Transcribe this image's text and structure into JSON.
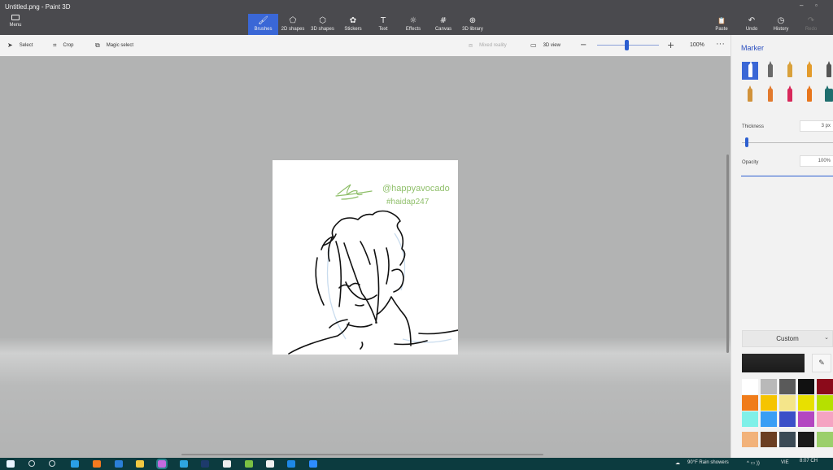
{
  "window": {
    "title": "Untitled.png - Paint 3D"
  },
  "ribbon": {
    "menu_label": "Menu",
    "tools": [
      {
        "label": "Brushes",
        "glyph": "🖌",
        "icon": "brush-icon"
      },
      {
        "label": "2D shapes",
        "glyph": "⬠",
        "icon": "shapes-2d-icon"
      },
      {
        "label": "3D shapes",
        "glyph": "⬡",
        "icon": "shapes-3d-icon"
      },
      {
        "label": "Stickers",
        "glyph": "✿",
        "icon": "sticker-icon"
      },
      {
        "label": "Text",
        "glyph": "T",
        "icon": "text-icon"
      },
      {
        "label": "Effects",
        "glyph": "☼",
        "icon": "effects-icon"
      },
      {
        "label": "Canvas",
        "glyph": "#",
        "icon": "canvas-icon"
      },
      {
        "label": "3D library",
        "glyph": "⊕",
        "icon": "library-icon"
      }
    ],
    "right_tools": [
      {
        "label": "Paste",
        "glyph": "📋",
        "icon": "paste-icon"
      },
      {
        "label": "Undo",
        "glyph": "↶",
        "icon": "undo-icon"
      },
      {
        "label": "History",
        "glyph": "◷",
        "icon": "history-icon"
      },
      {
        "label": "Redo",
        "glyph": "↷",
        "icon": "redo-icon"
      }
    ]
  },
  "toolbar": {
    "select": "Select",
    "crop": "Crop",
    "magic_select": "Magic select",
    "mixed_reality": "Mixed reality",
    "view_3d": "3D view",
    "zoom_value": "100%",
    "zoom_level": 0.45,
    "more": "···"
  },
  "canvas": {
    "handle_text": "@happyavocado",
    "hashtag_text": "#haidap247",
    "ink_color": "#111111",
    "accent_color": "#8fbf6a"
  },
  "panel": {
    "title": "Marker",
    "thickness_label": "Thickness",
    "thickness_value": "3 px",
    "thickness_level": 0.03,
    "opacity_label": "Opacity",
    "opacity_value": "100%",
    "custom_label": "Custom",
    "brushes_row1": [
      "#2b4fbf",
      "#6a6a6a",
      "#d9a13b",
      "#e39b2c",
      "#555"
    ],
    "brushes_row2": [
      "#d1923a",
      "#e27a2e",
      "#d8285b",
      "#e8761c",
      "#1f6e6e"
    ],
    "swatches": [
      "#ffffff",
      "#b9b9b9",
      "#5a5a5a",
      "#111111",
      "#8b0a1a",
      "#e31b23",
      "#f07c1a",
      "#f5c400",
      "#f4e58a",
      "#e8e000",
      "#b6e000",
      "#3bb34a",
      "#7ff0e8",
      "#3a9ef5",
      "#3b4fc8",
      "#b347c1",
      "#f5a3c2",
      "#c98555",
      "#f2b27a",
      "#6b3e22",
      "#3b4a55",
      "#1a1a1a",
      "#9bcf6b",
      "#6aa83a"
    ]
  },
  "taskbar": {
    "weather": "90°F  Rain showers",
    "lang": "VIE",
    "time": "8:07 CH",
    "icons": [
      {
        "name": "start-icon",
        "color": "#e8f4ff"
      },
      {
        "name": "search-icon",
        "color": "#cfd8dc"
      },
      {
        "name": "cortana-icon",
        "color": "#cfd8dc"
      },
      {
        "name": "edge-icon",
        "color": "#2aa0e6"
      },
      {
        "name": "firefox-icon",
        "color": "#f57a1f"
      },
      {
        "name": "mail-icon",
        "color": "#2b7fd8"
      },
      {
        "name": "explorer-icon",
        "color": "#f3c842"
      },
      {
        "name": "paint3d-icon",
        "color": "#c46adf"
      },
      {
        "name": "telegram-icon",
        "color": "#2ea6e0"
      },
      {
        "name": "photoshop-icon",
        "color": "#1d3a6b"
      },
      {
        "name": "notes-icon",
        "color": "#eeeeee"
      },
      {
        "name": "green-app-icon",
        "color": "#7bc043"
      },
      {
        "name": "capcut-icon",
        "color": "#f0f0f0"
      },
      {
        "name": "zalo-icon",
        "color": "#1e88e5"
      },
      {
        "name": "zoom-icon",
        "color": "#2d8cff"
      }
    ]
  }
}
